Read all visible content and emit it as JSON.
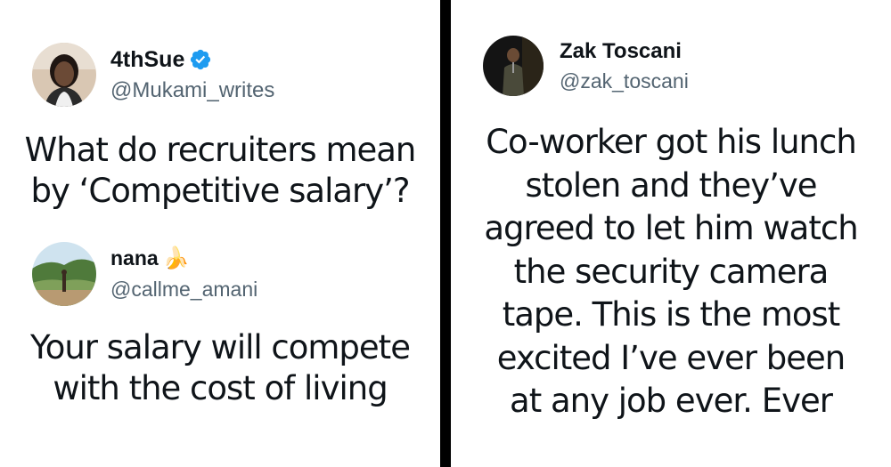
{
  "tweets": [
    {
      "display_name": "4thSue",
      "handle": "@Mukami_writes",
      "verified": true,
      "text_lines": [
        "What do recruiters mean",
        "by ‘Competitive salary’?"
      ]
    },
    {
      "display_name": "nana",
      "name_emoji": "🍌",
      "handle": "@callme_amani",
      "text_lines": [
        "Your salary will compete",
        "with the cost of living"
      ]
    },
    {
      "display_name": "Zak Toscani",
      "handle": "@zak_toscani",
      "text_lines": [
        "Co-worker got his lunch",
        "stolen and they’ve",
        "agreed to let him watch",
        "the security camera",
        "tape. This is the most",
        "excited I’ve ever been",
        "at any job ever. Ever"
      ]
    }
  ],
  "icons": {
    "verified": "verified-badge-icon",
    "emoji": "banana-emoji-icon"
  },
  "colors": {
    "verified_blue": "#1d9bf0",
    "handle_gray": "#536471",
    "divider": "#000000"
  }
}
